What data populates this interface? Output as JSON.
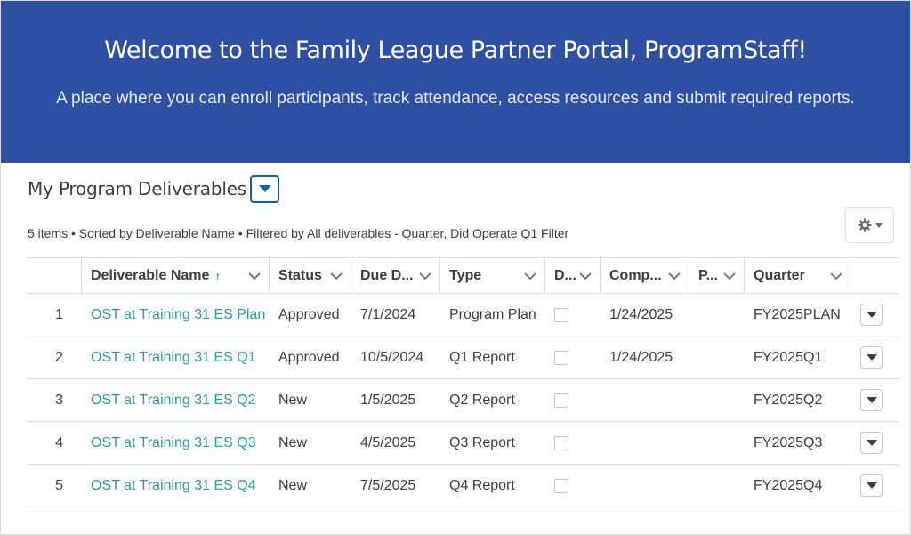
{
  "hero": {
    "title": "Welcome to the Family League Partner Portal, ProgramStaff!",
    "subtitle": "A place where you can enroll participants, track attendance, access resources and submit required reports."
  },
  "list": {
    "title": "My Program Deliverables",
    "meta": "5 items • Sorted by Deliverable Name • Filtered by All deliverables - Quarter, Did Operate Q1 Filter",
    "settings_icon": "gear-icon"
  },
  "columns": [
    {
      "label": "Deliverable Name",
      "sorted": "asc"
    },
    {
      "label": "Status"
    },
    {
      "label": "Due D..."
    },
    {
      "label": "Type"
    },
    {
      "label": "D..."
    },
    {
      "label": "Comp..."
    },
    {
      "label": "P..."
    },
    {
      "label": "Quarter"
    }
  ],
  "rows": [
    {
      "num": "1",
      "name": "OST at Training 31 ES Plan",
      "status": "Approved",
      "due": "7/1/2024",
      "type": "Program Plan",
      "checked": false,
      "completed": "1/24/2025",
      "p": "",
      "quarter": "FY2025PLAN"
    },
    {
      "num": "2",
      "name": "OST at Training 31 ES Q1",
      "status": "Approved",
      "due": "10/5/2024",
      "type": "Q1 Report",
      "checked": false,
      "completed": "1/24/2025",
      "p": "",
      "quarter": "FY2025Q1"
    },
    {
      "num": "3",
      "name": "OST at Training 31 ES Q2",
      "status": "New",
      "due": "1/5/2025",
      "type": "Q2 Report",
      "checked": false,
      "completed": "",
      "p": "",
      "quarter": "FY2025Q2"
    },
    {
      "num": "4",
      "name": "OST at Training 31 ES Q3",
      "status": "New",
      "due": "4/5/2025",
      "type": "Q3 Report",
      "checked": false,
      "completed": "",
      "p": "",
      "quarter": "FY2025Q3"
    },
    {
      "num": "5",
      "name": "OST at Training 31 ES Q4",
      "status": "New",
      "due": "7/5/2025",
      "type": "Q4 Report",
      "checked": false,
      "completed": "",
      "p": "",
      "quarter": "FY2025Q4"
    }
  ],
  "colors": {
    "hero_bg": "#2f4fa2",
    "link": "#2a9d9c",
    "accent": "#1b5f9e"
  }
}
